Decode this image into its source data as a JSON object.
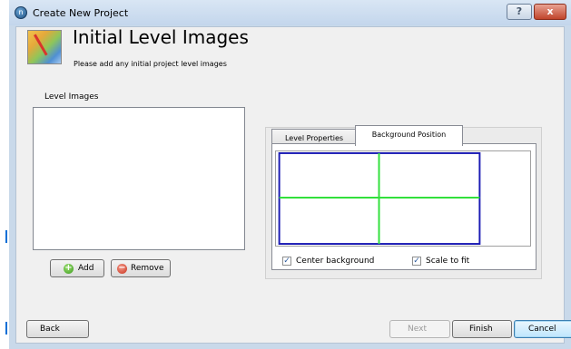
{
  "window": {
    "title": "Create New Project",
    "help_label": "?",
    "close_label": "x",
    "app_icon_letter": "n"
  },
  "header": {
    "title": "Initial Level Images",
    "subtitle": "Please add any initial project level images"
  },
  "level_images": {
    "label": "Level Images",
    "items": [],
    "add_label": "Add",
    "remove_label": "Remove"
  },
  "tabs": [
    {
      "label": "Level Properties",
      "selected": false
    },
    {
      "label": "Background Position",
      "selected": true
    }
  ],
  "background_position": {
    "center_background_label": "Center background",
    "center_background_checked": true,
    "scale_to_fit_label": "Scale to fit",
    "scale_to_fit_checked": true,
    "frame_color": "#1c1cb4",
    "crosshair_color": "#32e03c"
  },
  "footer": {
    "back_label": "Back",
    "next_label": "Next",
    "next_enabled": false,
    "finish_label": "Finish",
    "cancel_label": "Cancel"
  },
  "check_glyph": "✓"
}
